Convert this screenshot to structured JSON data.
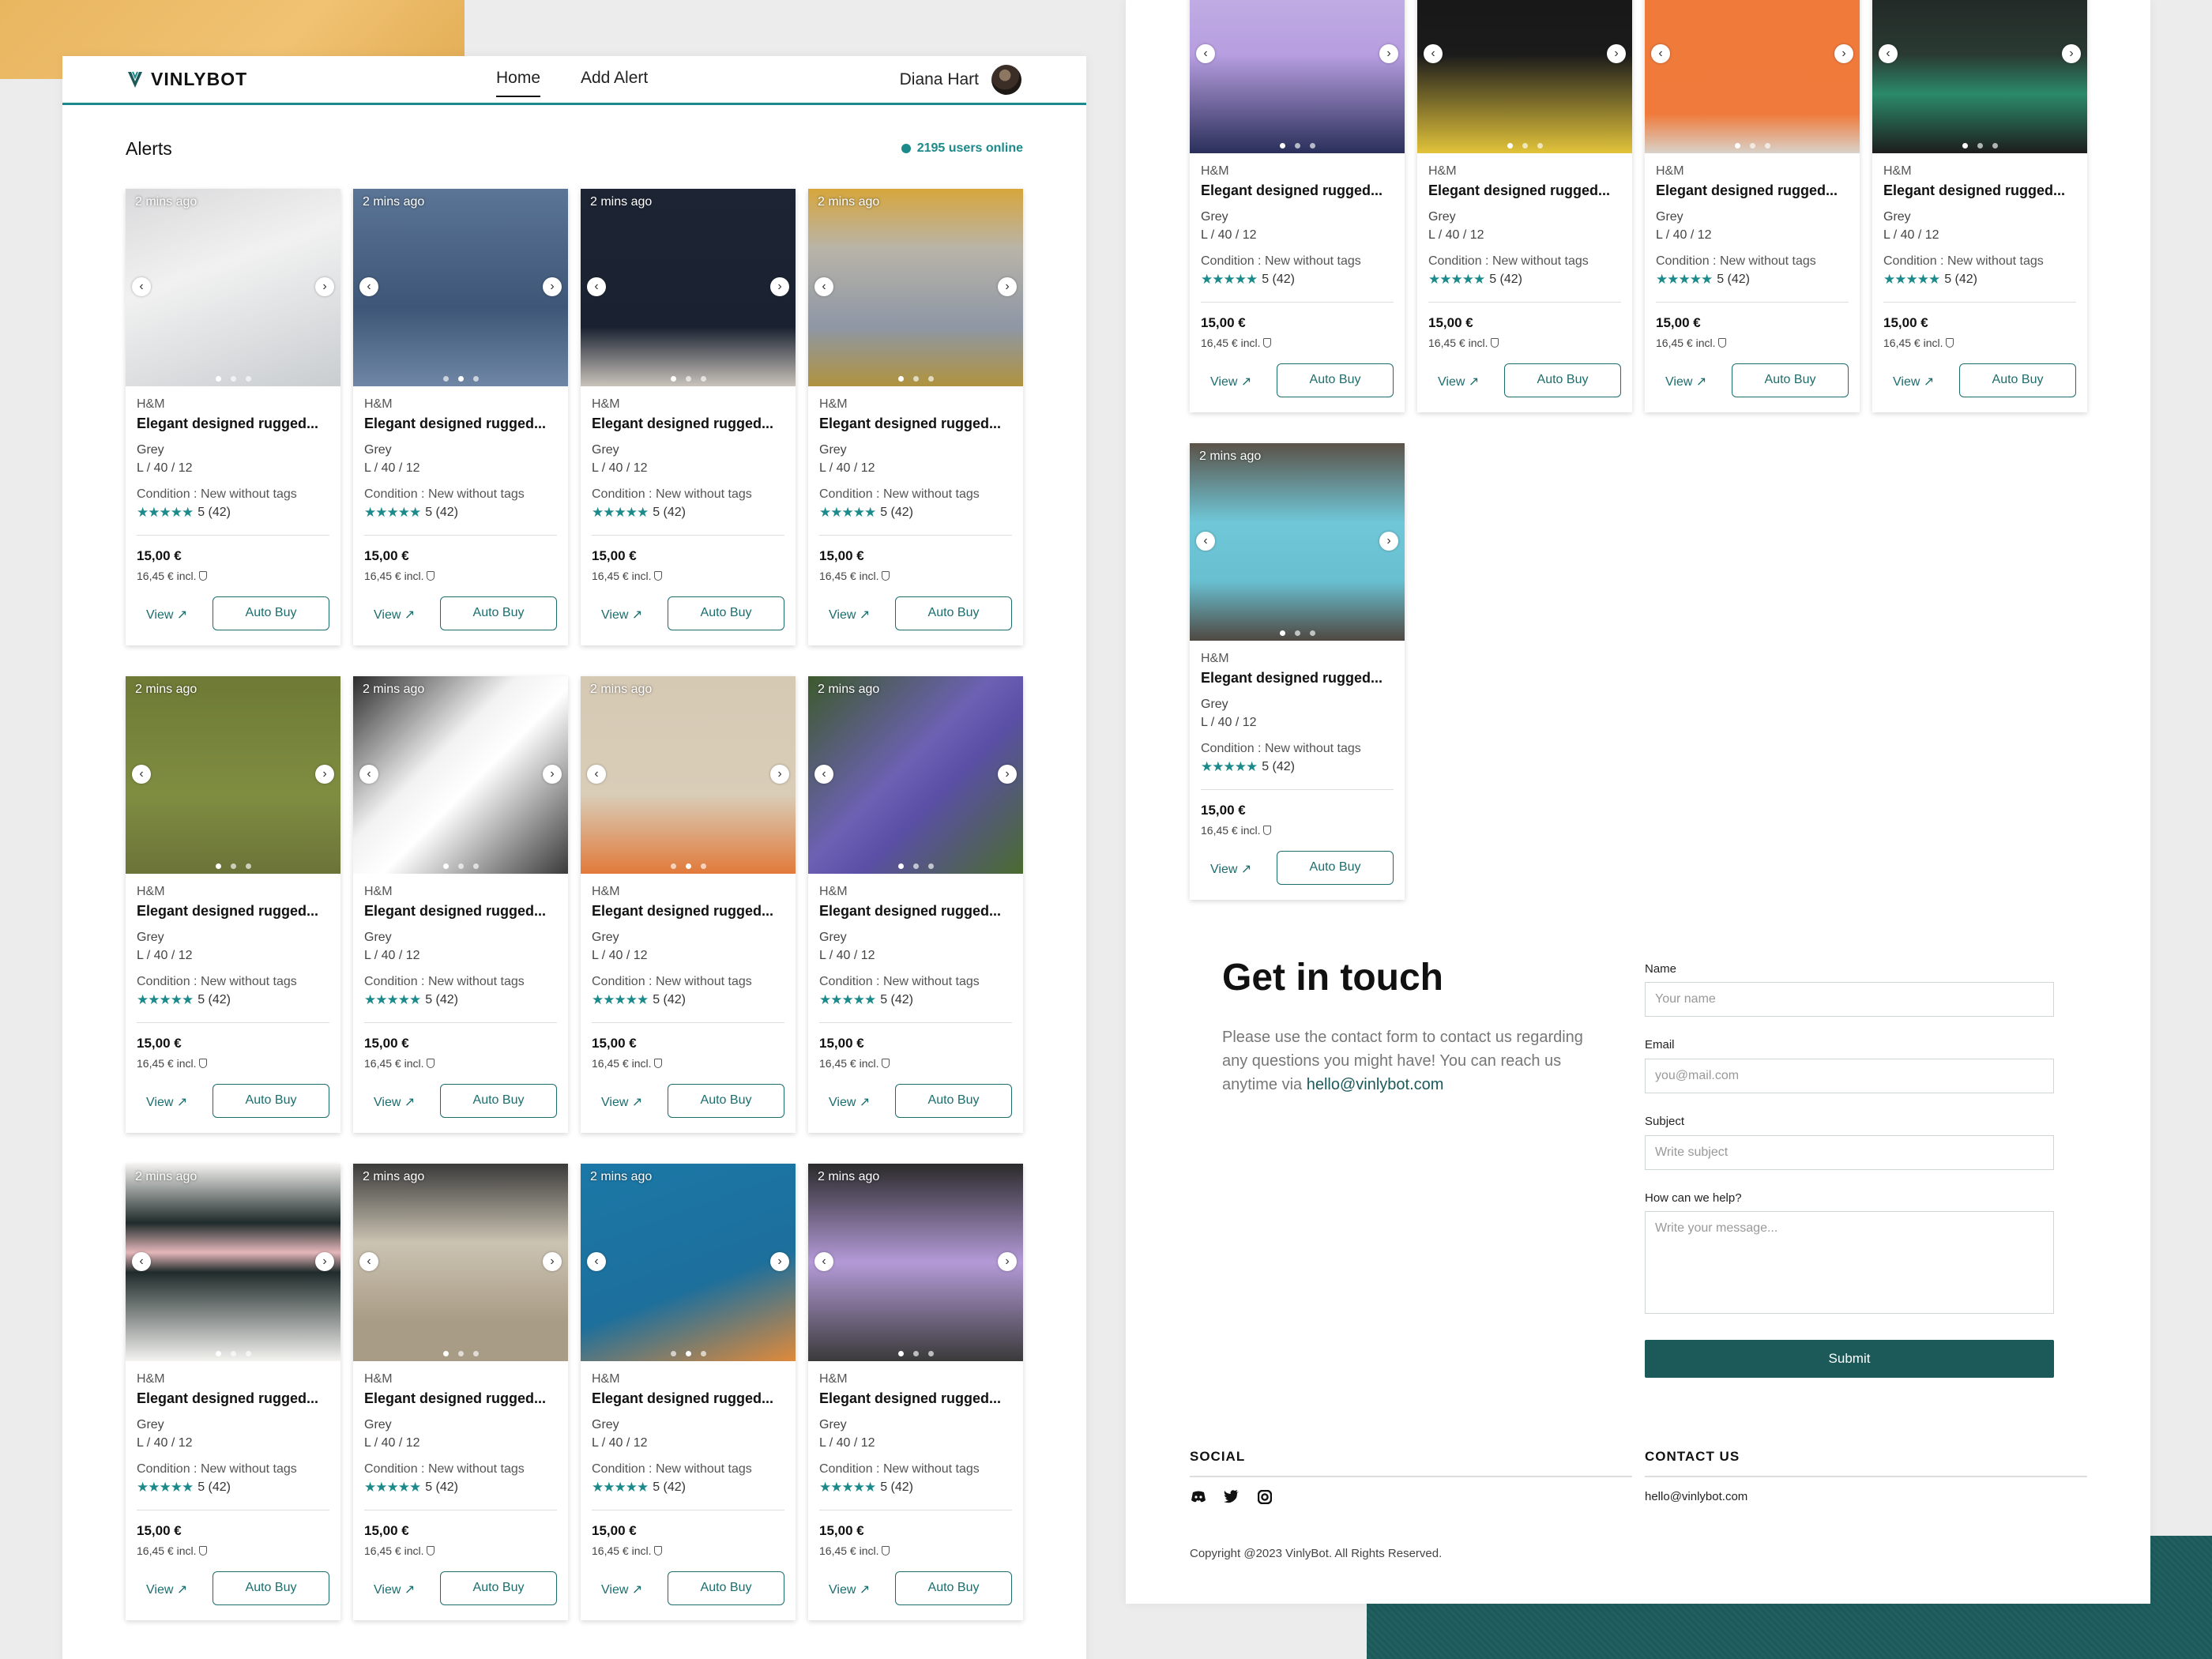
{
  "brand_name": "VINLYBOT",
  "nav": {
    "home": "Home",
    "add_alert": "Add Alert"
  },
  "user": {
    "name": "Diana Hart"
  },
  "alerts": {
    "title": "Alerts",
    "online": "2195 users online"
  },
  "card_common": {
    "brand": "H&M",
    "title": "Elegant designed rugged...",
    "color": "Grey",
    "size": "L / 40 / 12",
    "condition": "Condition : New without tags",
    "stars": "★★★★★",
    "rating": "5 (42)",
    "price": "15,00 €",
    "incl": "16,45 € incl.",
    "view_label": "View ↗",
    "autobuy_label": "Auto Buy",
    "time": "2 mins ago"
  },
  "cards_left": [
    {
      "img": "nike-sneakers",
      "active_dot": 0
    },
    {
      "img": "ripped-jeans",
      "active_dot": 1
    },
    {
      "img": "dark-jeans",
      "active_dot": 0
    },
    {
      "img": "wide-jeans",
      "active_dot": 0
    },
    {
      "img": "john-deere-cap",
      "active_dot": 0
    },
    {
      "img": "airpods-box",
      "active_dot": 0
    },
    {
      "img": "judy-moody-book",
      "active_dot": 1
    },
    {
      "img": "hydro-flask",
      "active_dot": 0
    },
    {
      "img": "striped-sweater",
      "active_dot": 0
    },
    {
      "img": "nightstand",
      "active_dot": 0
    },
    {
      "img": "foot-book",
      "active_dot": 1
    },
    {
      "img": "purple-toy-cat",
      "active_dot": 0
    }
  ],
  "cards_right": [
    {
      "img": "purple-sneakers",
      "active_dot": 0
    },
    {
      "img": "jersey-19",
      "active_dot": 0
    },
    {
      "img": "orange-phone-case",
      "active_dot": 0
    },
    {
      "img": "leopard-pendant",
      "active_dot": 0
    },
    {
      "img": "rainbow-slides",
      "active_dot": 0
    }
  ],
  "contact": {
    "title": "Get in touch",
    "text": "Please use the contact form to contact us regarding any questions you might have! You can reach us anytime via",
    "email": "hello@vinlybot.com",
    "name_label": "Name",
    "name_placeholder": "Your name",
    "email_label": "Email",
    "email_placeholder": "you@mail.com",
    "subject_label": "Subject",
    "subject_placeholder": "Write subject",
    "help_label": "How can we help?",
    "help_placeholder": "Write your message...",
    "submit_label": "Submit"
  },
  "footer": {
    "social_heading": "SOCIAL",
    "contact_heading": "CONTACT US",
    "contact_email": "hello@vinlybot.com",
    "social_icons": [
      "discord-icon",
      "twitter-icon",
      "instagram-icon"
    ],
    "copyright": "Copyright @2023 VinlyBot. All Rights Reserved."
  },
  "colors": {
    "accent": "#1c8a8a",
    "dark_accent": "#1c5a5a",
    "star": "#1c8a8a"
  }
}
